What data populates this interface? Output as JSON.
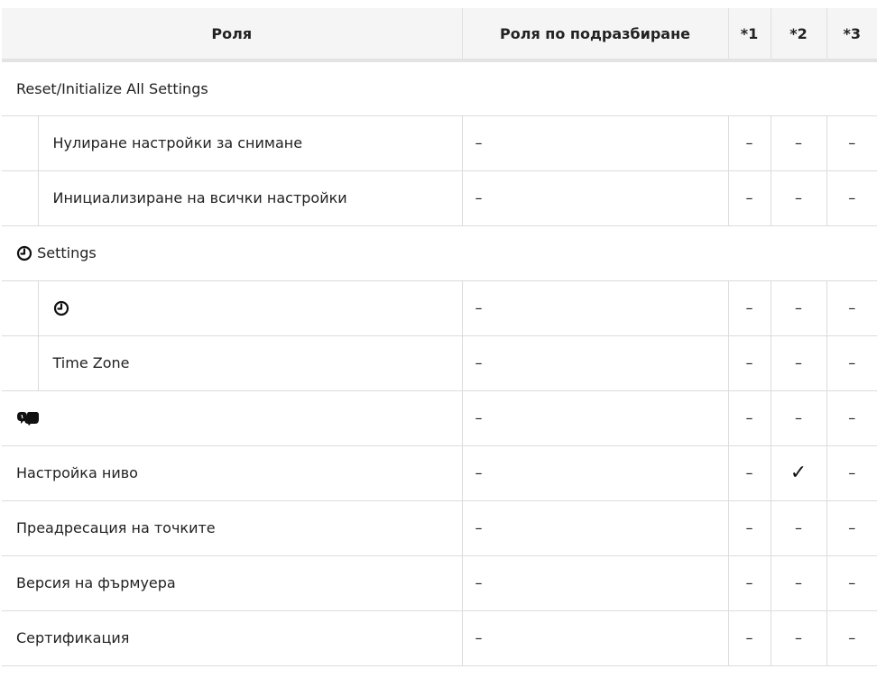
{
  "headers": {
    "role": "Роля",
    "default_role": "Роля по подразбиране",
    "c1": "*1",
    "c2": "*2",
    "c3": "*3"
  },
  "sections": {
    "reset": {
      "title": "Reset/Initialize All Settings"
    },
    "clock": {
      "title": "Settings",
      "icon": "clock-icon"
    }
  },
  "rows": {
    "reset_shooting": {
      "name": "Нулиране настройки за снимане",
      "default": "–",
      "c1": "–",
      "c2": "–",
      "c3": "–"
    },
    "init_all": {
      "name": "Инициализиране на всички настройки",
      "default": "–",
      "c1": "–",
      "c2": "–",
      "c3": "–"
    },
    "clock_setting": {
      "icon": "clock-icon",
      "default": "–",
      "c1": "–",
      "c2": "–",
      "c3": "–"
    },
    "time_zone": {
      "name": "Time Zone",
      "default": "–",
      "c1": "–",
      "c2": "–",
      "c3": "–"
    },
    "language": {
      "icon": "language-icon",
      "default": "–",
      "c1": "–",
      "c2": "–",
      "c3": "–"
    },
    "level_adjust": {
      "name": "Настройка ниво",
      "default": "–",
      "c1": "–",
      "c2": "✓",
      "c3": "–"
    },
    "pixel_mapping": {
      "name": "Преадресация на точките",
      "default": "–",
      "c1": "–",
      "c2": "–",
      "c3": "–"
    },
    "firmware": {
      "name": "Версия на фърмуера",
      "default": "–",
      "c1": "–",
      "c2": "–",
      "c3": "–"
    },
    "certification": {
      "name": "Сертификация",
      "default": "–",
      "c1": "–",
      "c2": "–",
      "c3": "–"
    }
  }
}
